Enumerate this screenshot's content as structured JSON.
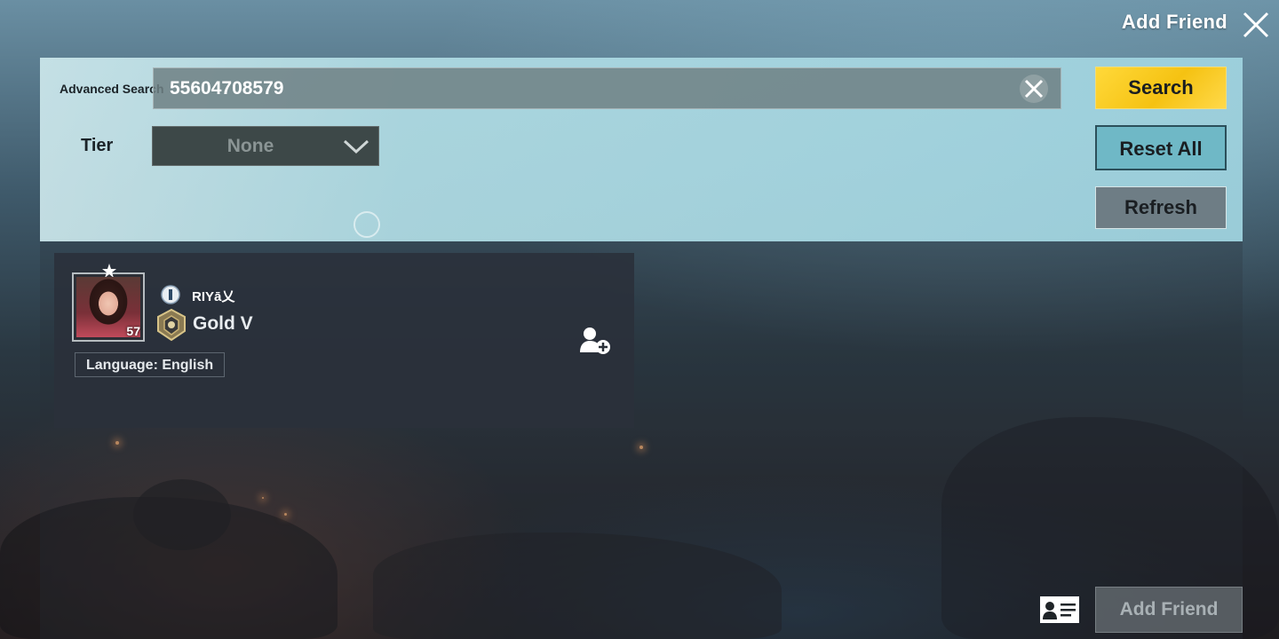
{
  "header": {
    "title": "Add Friend",
    "close_icon": "close-icon"
  },
  "search": {
    "advanced_label": "Advanced Search",
    "query": "55604708579",
    "clear_icon": "clear-x-icon",
    "tier_label": "Tier",
    "tier_value": "None",
    "tier_chevron_icon": "chevron-down-icon",
    "search_button": "Search",
    "reset_button": "Reset All",
    "refresh_button": "Refresh"
  },
  "results": [
    {
      "name": "RIYā乂",
      "level": "57",
      "tier": "Gold V",
      "language": "Language: English",
      "add_icon": "add-user-icon"
    }
  ],
  "footer": {
    "id_card_icon": "id-card-icon",
    "add_friend_button": "Add Friend"
  },
  "colors": {
    "search_button": "#f5c212",
    "reset_button": "#6fb8c6",
    "refresh_button": "#6e7d85",
    "panel": "#a0d4e0"
  }
}
